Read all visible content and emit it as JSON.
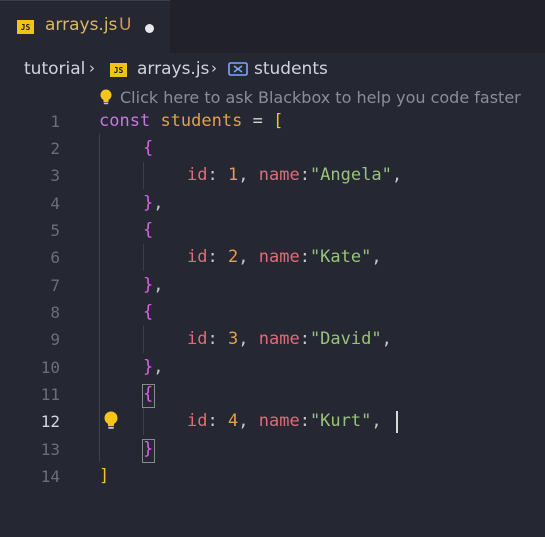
{
  "tab": {
    "filename": "arrays.js",
    "status": "U",
    "badge": "JS"
  },
  "breadcrumb": {
    "folder": "tutorial",
    "file": "arrays.js",
    "symbol": "students",
    "badge": "JS"
  },
  "hint": {
    "text": "Click here to ask Blackbox to help you code faster"
  },
  "editor": {
    "active_line": 12,
    "line_numbers": [
      "1",
      "2",
      "3",
      "4",
      "5",
      "6",
      "7",
      "8",
      "9",
      "10",
      "11",
      "12",
      "13",
      "14"
    ],
    "code": {
      "l1": {
        "kw": "const",
        "var": "students",
        "eq": "=",
        "open": "["
      },
      "l2": {
        "brace": "{"
      },
      "l3": {
        "prop1": "id",
        "colon1": ":",
        "num": "1",
        "comma1": ",",
        "prop2": "name",
        "colon2": ":",
        "str": "\"Angela\"",
        "comma2": ","
      },
      "l4": {
        "brace": "}",
        "comma": ","
      },
      "l5": {
        "brace": "{"
      },
      "l6": {
        "prop1": "id",
        "colon1": ":",
        "num": "2",
        "comma1": ",",
        "prop2": "name",
        "colon2": ":",
        "str": "\"Kate\"",
        "comma2": ","
      },
      "l7": {
        "brace": "}",
        "comma": ","
      },
      "l8": {
        "brace": "{"
      },
      "l9": {
        "prop1": "id",
        "colon1": ":",
        "num": "3",
        "comma1": ",",
        "prop2": "name",
        "colon2": ":",
        "str": "\"David\"",
        "comma2": ","
      },
      "l10": {
        "brace": "}",
        "comma": ","
      },
      "l11": {
        "brace": "{"
      },
      "l12": {
        "prop1": "id",
        "colon1": ":",
        "num": "4",
        "comma1": ",",
        "prop2": "name",
        "colon2": ":",
        "str": "\"Kurt\"",
        "comma2": ","
      },
      "l13": {
        "brace": "}"
      },
      "l14": {
        "close": "]"
      }
    }
  },
  "icons": {
    "tab_modified": "dot-icon",
    "symbol": "variable-icon",
    "hint": "lightbulb-icon",
    "gutter": "lightbulb-icon"
  }
}
